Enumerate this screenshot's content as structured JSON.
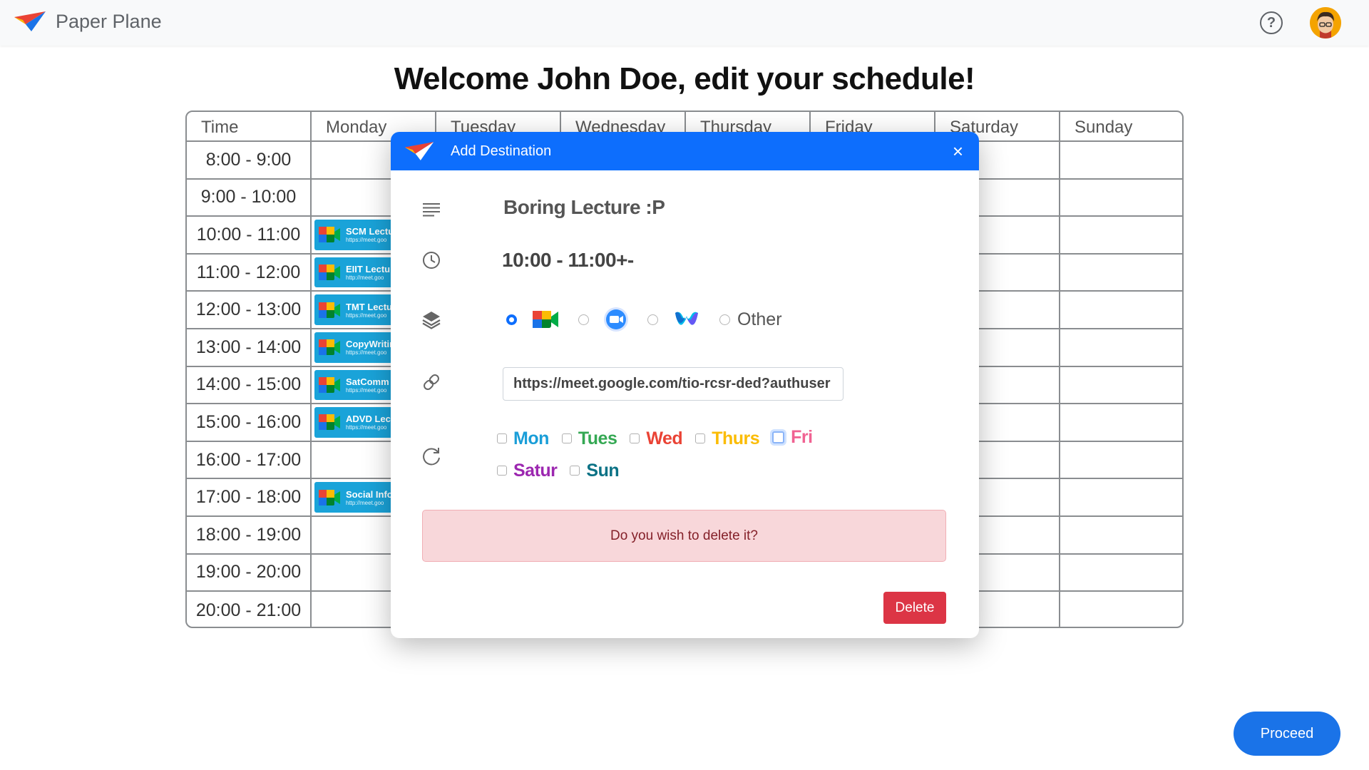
{
  "app": {
    "name": "Paper Plane"
  },
  "header": {
    "help_icon": "question-circle-icon",
    "help_glyph": "?",
    "avatar_icon": "user-avatar"
  },
  "page": {
    "title": "Welcome John Doe, edit your schedule!"
  },
  "schedule": {
    "columns": [
      "Time",
      "Monday",
      "Tuesday",
      "Wednesday",
      "Thursday",
      "Friday",
      "Saturday",
      "Sunday"
    ],
    "times": [
      "8:00 - 9:00",
      "9:00 - 10:00",
      "10:00 - 11:00",
      "11:00 - 12:00",
      "12:00 - 13:00",
      "13:00 - 14:00",
      "14:00 - 15:00",
      "15:00 - 16:00",
      "16:00 - 17:00",
      "17:00 - 18:00",
      "18:00 - 19:00",
      "19:00 - 20:00",
      "20:00 - 21:00"
    ],
    "monday_events": [
      {
        "slot": 2,
        "title": "SCM Lectu",
        "link": "https://meet.goo"
      },
      {
        "slot": 3,
        "title": "EIIT Lectur",
        "link": "http://meet.goo"
      },
      {
        "slot": 4,
        "title": "TMT Lectu",
        "link": "https://meet.goo"
      },
      {
        "slot": 5,
        "title": "CopyWritin",
        "link": "https://meet.goo"
      },
      {
        "slot": 6,
        "title": "SatComm",
        "link": "https://meet.goo"
      },
      {
        "slot": 7,
        "title": "ADVD Lec",
        "link": "https://meet.goo"
      },
      {
        "slot": 9,
        "title": "Social Info",
        "link": "http://meet.goo"
      }
    ],
    "event_color": "#1aa3d9"
  },
  "modal": {
    "title": "Add Destination",
    "close_glyph": "×",
    "event_title": "Boring Lecture :P",
    "event_time": "10:00 - 11:00+-",
    "platforms": {
      "options": [
        "google-meet",
        "zoom",
        "webex",
        "other"
      ],
      "selected": "google-meet",
      "other_label": "Other"
    },
    "link_value": "https://meet.google.com/tio-rcsr-ded?authuser",
    "days": [
      {
        "label": "Mon",
        "color": "#1a9ed8",
        "checked": false
      },
      {
        "label": "Tues",
        "color": "#34a853",
        "checked": false
      },
      {
        "label": "Wed",
        "color": "#ea4335",
        "checked": false
      },
      {
        "label": "Thurs",
        "color": "#fbbc04",
        "checked": false
      },
      {
        "label": "Fri",
        "color": "#f06292",
        "checked": false
      },
      {
        "label": "Satur",
        "color": "#9c27b0",
        "checked": false
      },
      {
        "label": "Sun",
        "color": "#0b7285",
        "checked": false
      }
    ],
    "alert_text": "Do you wish to delete it?",
    "delete_label": "Delete"
  },
  "footer": {
    "proceed_label": "Proceed"
  },
  "colors": {
    "primary": "#0d6efd",
    "danger": "#dc3545",
    "alert_bg": "#f8d7da"
  }
}
